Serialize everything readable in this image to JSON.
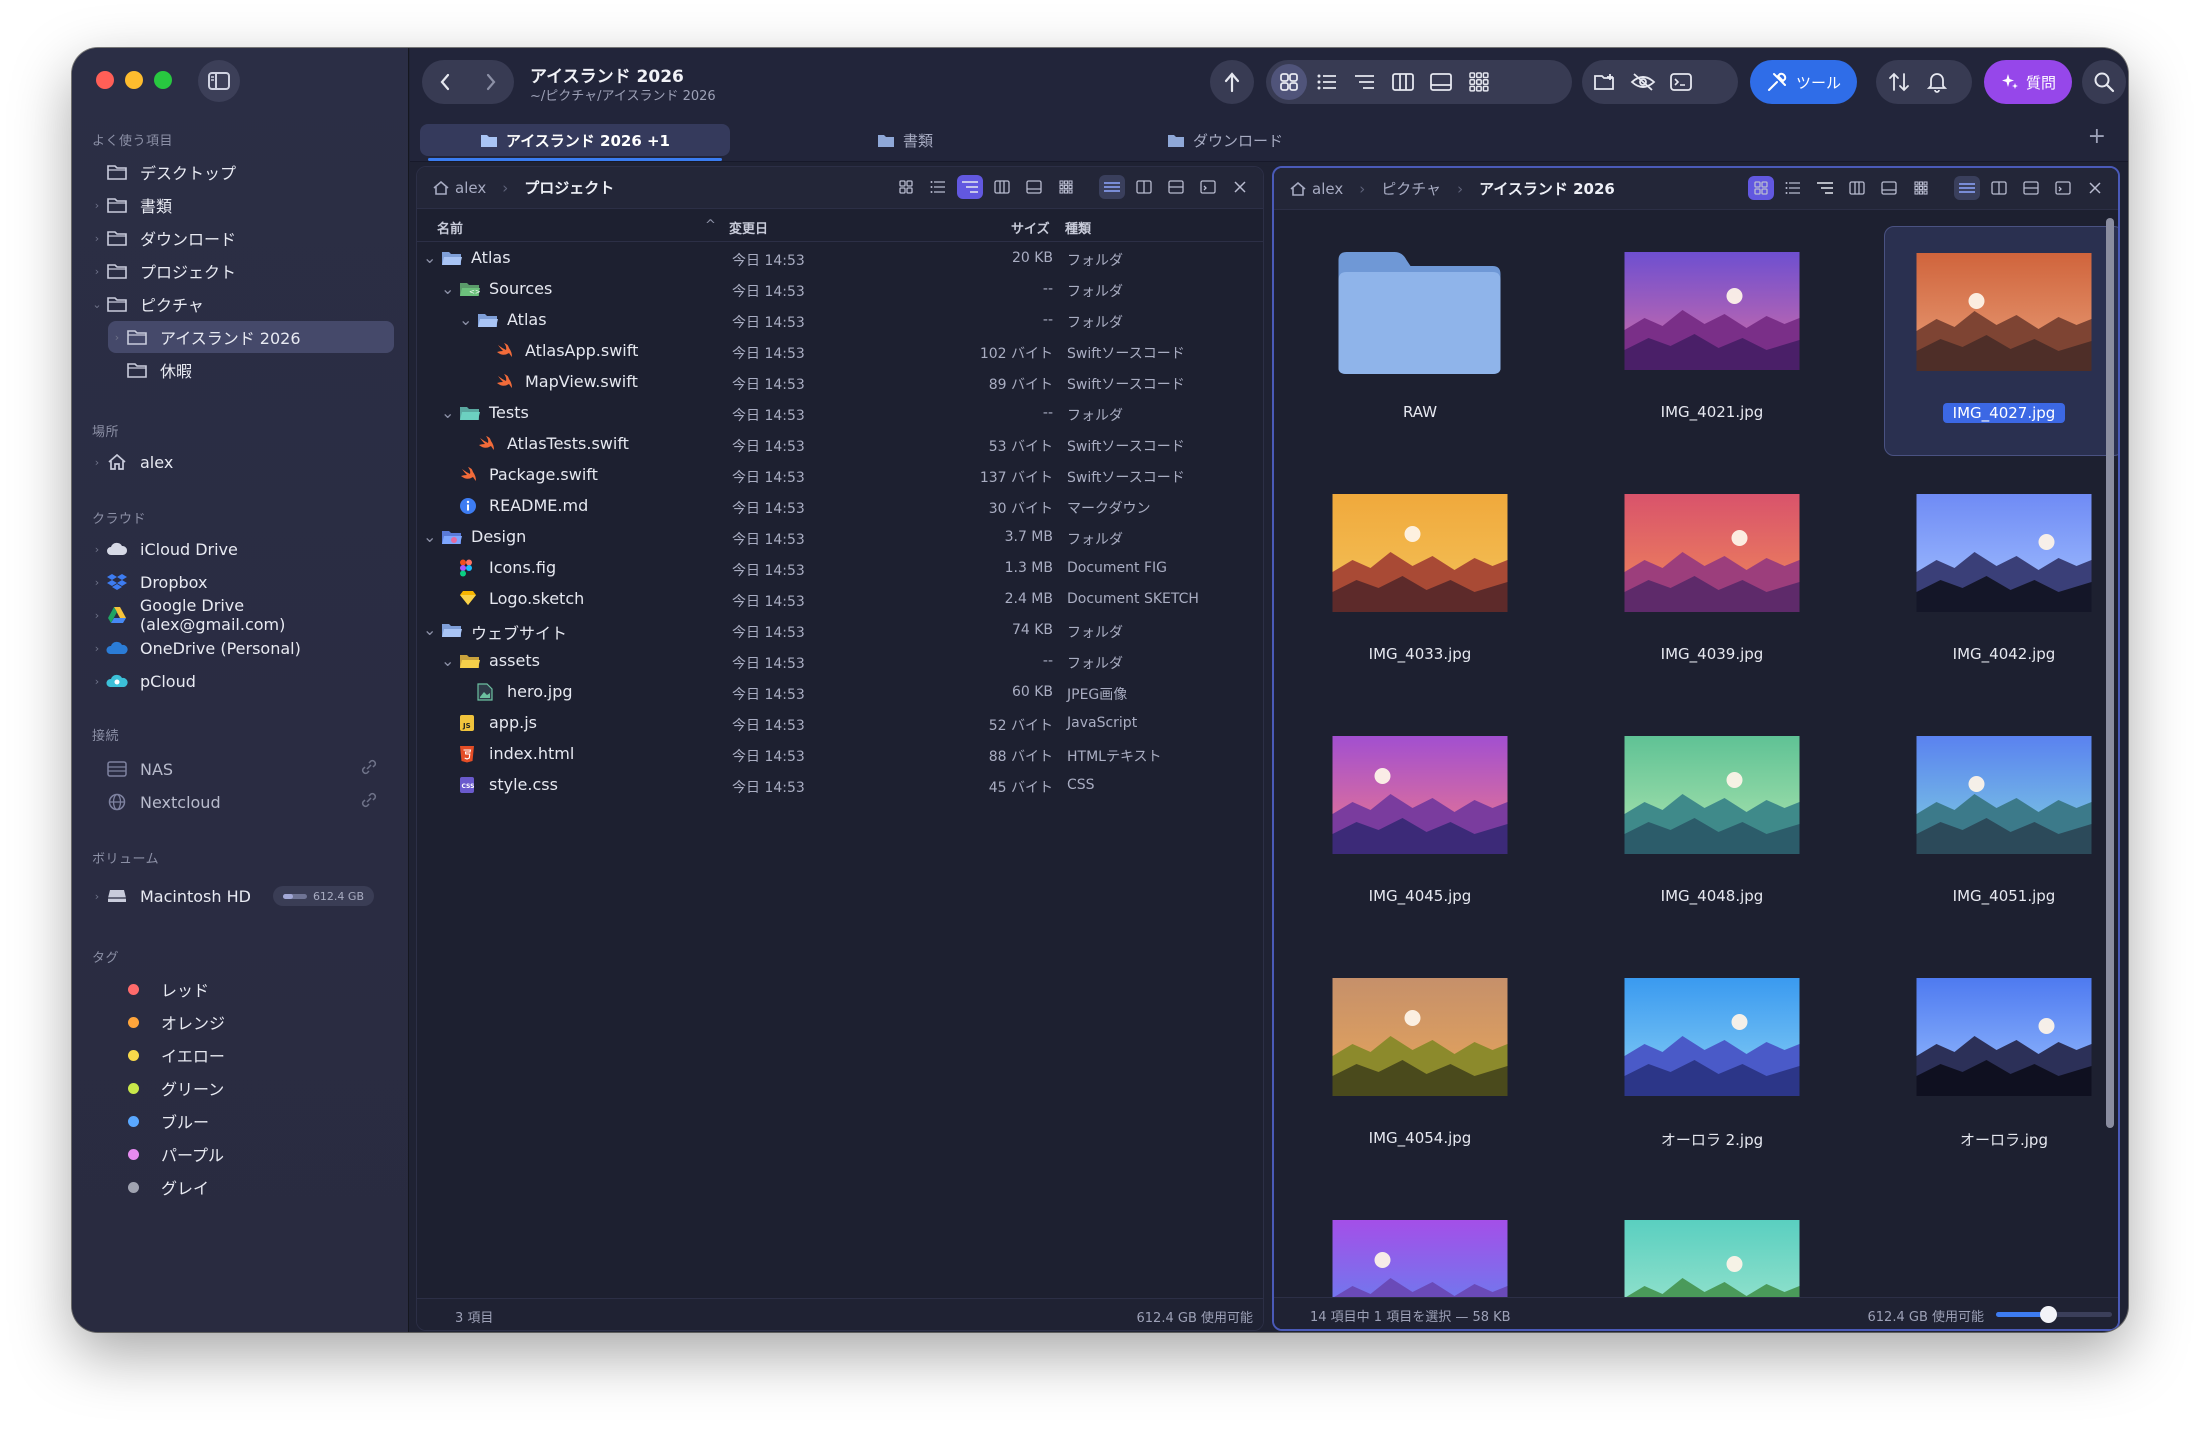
{
  "window": {
    "title": "アイスランド 2026",
    "path": "~/ピクチャ/アイスランド 2026"
  },
  "sidebar": {
    "favorites_title": "よく使う項目",
    "favorites": [
      {
        "label": "デスクトップ",
        "icon": "folder-icon"
      },
      {
        "label": "書類",
        "icon": "folder-icon"
      },
      {
        "label": "ダウンロード",
        "icon": "folder-icon"
      },
      {
        "label": "プロジェクト",
        "icon": "folder-icon"
      },
      {
        "label": "ピクチャ",
        "icon": "folder-icon"
      },
      {
        "label": "アイスランド 2026",
        "icon": "folder-icon"
      },
      {
        "label": "休暇",
        "icon": "folder-icon"
      }
    ],
    "places_title": "場所",
    "places": [
      {
        "label": "alex",
        "icon": "home-icon"
      }
    ],
    "cloud_title": "クラウド",
    "cloud": [
      {
        "label": "iCloud Drive",
        "icon": "cloud-icon"
      },
      {
        "label": "Dropbox",
        "icon": "dropbox-icon"
      },
      {
        "label": "Google Drive (alex@gmail.com)",
        "icon": "google-drive-icon"
      },
      {
        "label": "OneDrive (Personal)",
        "icon": "onedrive-icon"
      },
      {
        "label": "pCloud",
        "icon": "pcloud-icon"
      }
    ],
    "connections_title": "接続",
    "connections": [
      {
        "label": "NAS",
        "icon": "nas-icon"
      },
      {
        "label": "Nextcloud",
        "icon": "globe-icon"
      }
    ],
    "volumes_title": "ボリューム",
    "volume": {
      "label": "Macintosh HD",
      "free": "612.4 GB",
      "used_fraction": 0.4
    },
    "tags_title": "タグ",
    "tags": [
      {
        "label": "レッド",
        "color": "#ff6b6b"
      },
      {
        "label": "オレンジ",
        "color": "#ffa53b"
      },
      {
        "label": "イエロー",
        "color": "#f7d84b"
      },
      {
        "label": "グリーン",
        "color": "#c9e84a"
      },
      {
        "label": "ブルー",
        "color": "#5aa8ff"
      },
      {
        "label": "パープル",
        "color": "#e68bf0"
      },
      {
        "label": "グレイ",
        "color": "#a0a3b1"
      }
    ]
  },
  "toolbar": {
    "tools_label": "ツール",
    "ask_label": "質問"
  },
  "tabs": [
    {
      "label": "アイスランド 2026 +1",
      "active": true
    },
    {
      "label": "書類",
      "active": false
    },
    {
      "label": "ダウンロード",
      "active": false
    }
  ],
  "left_pane": {
    "breadcrumb": {
      "root": "alex",
      "current": "プロジェクト"
    },
    "columns": {
      "name": "名前",
      "date": "変更日",
      "size": "サイズ",
      "kind": "種類"
    },
    "rows": [
      {
        "name": "Atlas",
        "date": "今日 14:53",
        "size": "20 KB",
        "kind": "フォルダ",
        "depth": 0,
        "type": "folder-open",
        "expand": "open"
      },
      {
        "name": "Sources",
        "date": "今日 14:53",
        "size": "--",
        "kind": "フォルダ",
        "depth": 1,
        "type": "folder-code",
        "expand": "open"
      },
      {
        "name": "Atlas",
        "date": "今日 14:53",
        "size": "--",
        "kind": "フォルダ",
        "depth": 2,
        "type": "folder-open",
        "expand": "open"
      },
      {
        "name": "AtlasApp.swift",
        "date": "今日 14:53",
        "size": "102 バイト",
        "kind": "Swiftソースコード",
        "depth": 3,
        "type": "swift"
      },
      {
        "name": "MapView.swift",
        "date": "今日 14:53",
        "size": "89 バイト",
        "kind": "Swiftソースコード",
        "depth": 3,
        "type": "swift"
      },
      {
        "name": "Tests",
        "date": "今日 14:53",
        "size": "--",
        "kind": "フォルダ",
        "depth": 1,
        "type": "folder-test",
        "expand": "open"
      },
      {
        "name": "AtlasTests.swift",
        "date": "今日 14:53",
        "size": "53 バイト",
        "kind": "Swiftソースコード",
        "depth": 2,
        "type": "swift"
      },
      {
        "name": "Package.swift",
        "date": "今日 14:53",
        "size": "137 バイト",
        "kind": "Swiftソースコード",
        "depth": 1,
        "type": "swift"
      },
      {
        "name": "README.md",
        "date": "今日 14:53",
        "size": "30 バイト",
        "kind": "マークダウン",
        "depth": 1,
        "type": "info"
      },
      {
        "name": "Design",
        "date": "今日 14:53",
        "size": "3.7 MB",
        "kind": "フォルダ",
        "depth": 0,
        "type": "folder-design",
        "expand": "open"
      },
      {
        "name": "Icons.fig",
        "date": "今日 14:53",
        "size": "1.3 MB",
        "kind": "Document FIG",
        "depth": 1,
        "type": "figma"
      },
      {
        "name": "Logo.sketch",
        "date": "今日 14:53",
        "size": "2.4 MB",
        "kind": "Document SKETCH",
        "depth": 1,
        "type": "sketch"
      },
      {
        "name": "ウェブサイト",
        "date": "今日 14:53",
        "size": "74 KB",
        "kind": "フォルダ",
        "depth": 0,
        "type": "folder-open",
        "expand": "open"
      },
      {
        "name": "assets",
        "date": "今日 14:53",
        "size": "--",
        "kind": "フォルダ",
        "depth": 1,
        "type": "folder-yellow",
        "expand": "open"
      },
      {
        "name": "hero.jpg",
        "date": "今日 14:53",
        "size": "60 KB",
        "kind": "JPEG画像",
        "depth": 2,
        "type": "image"
      },
      {
        "name": "app.js",
        "date": "今日 14:53",
        "size": "52 バイト",
        "kind": "JavaScript",
        "depth": 1,
        "type": "js"
      },
      {
        "name": "index.html",
        "date": "今日 14:53",
        "size": "88 バイト",
        "kind": "HTMLテキスト",
        "depth": 1,
        "type": "html"
      },
      {
        "name": "style.css",
        "date": "今日 14:53",
        "size": "45 バイト",
        "kind": "CSS",
        "depth": 1,
        "type": "css"
      }
    ],
    "status_left": "3 項目",
    "status_right": "612.4 GB 使用可能"
  },
  "right_pane": {
    "breadcrumb": {
      "root": "alex",
      "middle": "ピクチャ",
      "current": "アイスランド 2026"
    },
    "items": [
      {
        "name": "RAW",
        "type": "folder"
      },
      {
        "name": "IMG_4021.jpg",
        "type": "image",
        "colors": [
          "#6e4fd0",
          "#d66ea5"
        ],
        "hill": "#7a2f88",
        "hill2": "#4a1f68"
      },
      {
        "name": "IMG_4027.jpg",
        "type": "image",
        "colors": [
          "#d0643c",
          "#e9a07a"
        ],
        "hill": "#7e4433",
        "hill2": "#4e2e28",
        "selected": true
      },
      {
        "name": "IMG_4033.jpg",
        "type": "image",
        "colors": [
          "#f0a93c",
          "#f4c35a"
        ],
        "hill": "#a94a35",
        "hill2": "#5d2a2a"
      },
      {
        "name": "IMG_4039.jpg",
        "type": "image",
        "colors": [
          "#d9536b",
          "#f08a5a"
        ],
        "hill": "#9c3e7c",
        "hill2": "#5e2a6a"
      },
      {
        "name": "IMG_4042.jpg",
        "type": "image",
        "colors": [
          "#6f8bf5",
          "#a5c3ff"
        ],
        "hill": "#3a3f78",
        "hill2": "#141628"
      },
      {
        "name": "IMG_4045.jpg",
        "type": "image",
        "colors": [
          "#a24fd0",
          "#f07a8a"
        ],
        "hill": "#7a3c9e",
        "hill2": "#3c2a78"
      },
      {
        "name": "IMG_4048.jpg",
        "type": "image",
        "colors": [
          "#5fc295",
          "#b0e6b0"
        ],
        "hill": "#3f8a8a",
        "hill2": "#2c5c6a"
      },
      {
        "name": "IMG_4051.jpg",
        "type": "image",
        "colors": [
          "#5a82f0",
          "#7fd0e0"
        ],
        "hill": "#3c7a8a",
        "hill2": "#2c4a5a"
      },
      {
        "name": "IMG_4054.jpg",
        "type": "image",
        "colors": [
          "#c6906a",
          "#e8a65a"
        ],
        "hill": "#8c8a2c",
        "hill2": "#4a4a1c"
      },
      {
        "name": "オーロラ 2.jpg",
        "type": "image",
        "colors": [
          "#3a9af0",
          "#8ad0f5"
        ],
        "hill": "#4a5ac8",
        "hill2": "#2c3688"
      },
      {
        "name": "オーロラ.jpg",
        "type": "image",
        "colors": [
          "#4e7af0",
          "#9ac0ff"
        ],
        "hill": "#2c3058",
        "hill2": "#0f1020"
      },
      {
        "name": "",
        "type": "image",
        "colors": [
          "#a44fe8",
          "#5a8af0"
        ],
        "hill": "#6a4ab8",
        "hill2": "#3a2a88"
      },
      {
        "name": "",
        "type": "image",
        "colors": [
          "#5acfc0",
          "#a6e8d0"
        ],
        "hill": "#4a9a5a",
        "hill2": "#2c6a3a"
      }
    ],
    "status_left": "14 項目中 1 項目を選択 — 58 KB",
    "status_right": "612.4 GB 使用可能",
    "zoom": 0.45
  }
}
